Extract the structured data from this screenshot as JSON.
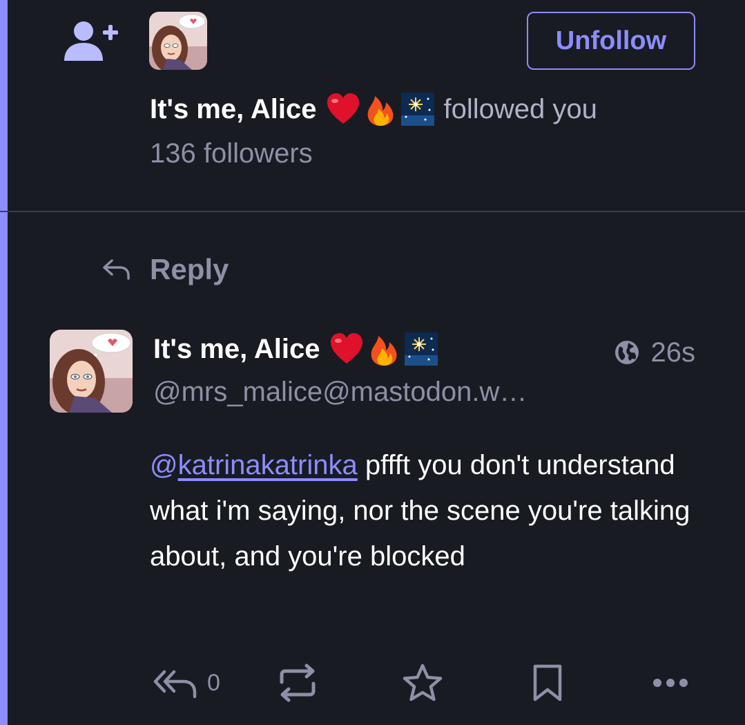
{
  "notification": {
    "account_name": "It's me, Alice",
    "emojis": [
      "heart-emoji",
      "fire-emoji",
      "fireworks-emoji"
    ],
    "action_text": "followed you",
    "followers_text": "136 followers",
    "unfollow_label": "Unfollow"
  },
  "status": {
    "context_label": "Reply",
    "display_name": "It's me, Alice",
    "account_handle": "@mrs_malice@mastodon.w…",
    "relative_time": "26s",
    "visibility_icon": "globe-icon",
    "mention_at": "@",
    "mention_user": "katrinakatrinka",
    "body_text": " pffft you don't understand what i'm saying, nor the scene you're talking about, and you're blocked",
    "reply_count": "0"
  },
  "colors": {
    "background": "#191b22",
    "accent": "#8c8dff",
    "muted": "#8d90a6",
    "divider": "#393f4f"
  }
}
